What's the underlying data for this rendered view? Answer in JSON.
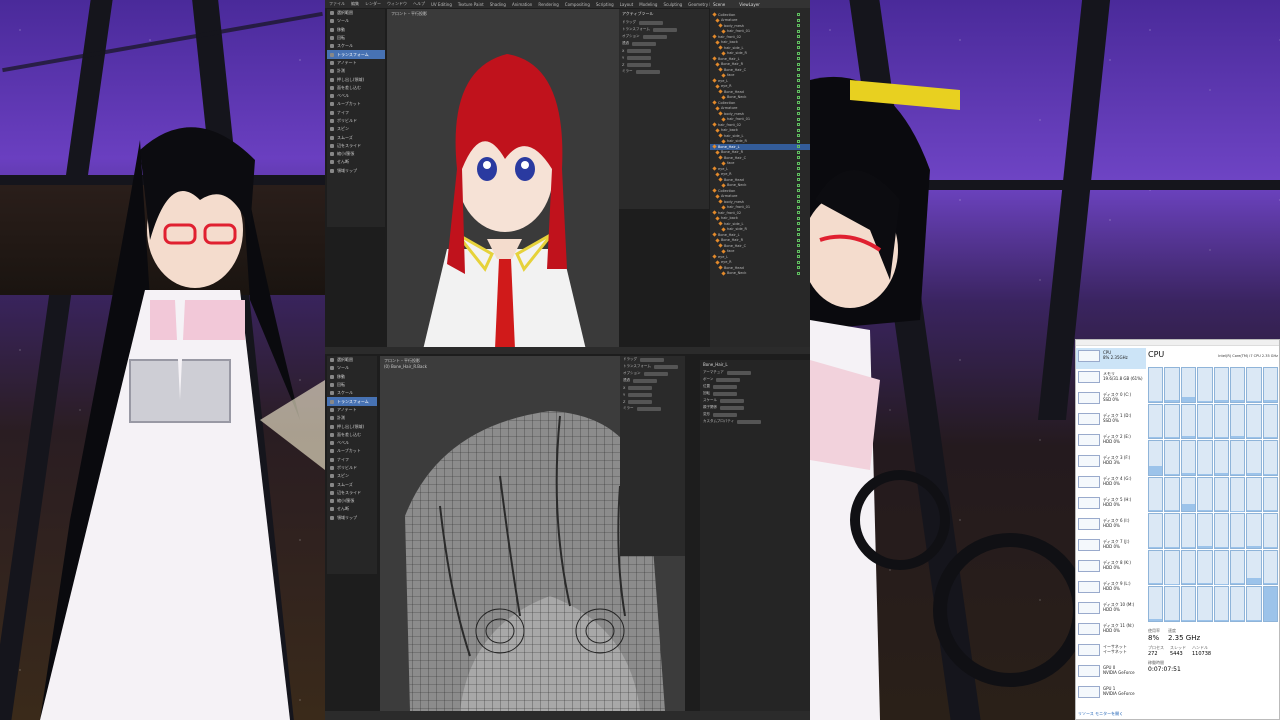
{
  "blender": {
    "topbar_menus": [
      "ファイル",
      "編集",
      "レンダー",
      "ウィンドウ",
      "ヘルプ",
      "UV Editing",
      "Texture Paint",
      "Shading",
      "Animation",
      "Rendering",
      "Compositing",
      "Scripting",
      "Layout",
      "Modeling",
      "Sculpting",
      "Geometry Nodes"
    ],
    "scene_label": "Scene",
    "view_layer_label": "ViewLayer",
    "top_tools": [
      "選択範囲",
      "ツール",
      "移動",
      "回転",
      "スケール",
      "トランスフォーム",
      "アノテート",
      "計測",
      "押し出し(領域)",
      "面を差し込む",
      "ベベル",
      "ループカット",
      "ナイフ",
      "ポリビルド",
      "スピン",
      "スムーズ",
      "辺をスライド",
      "縮小/膨張",
      "せん断",
      "領域リップ"
    ],
    "bottom_tools": [
      "選択範囲",
      "ツール",
      "移動",
      "回転",
      "スケール",
      "トランスフォーム",
      "アノテート",
      "計測",
      "押し出し(領域)",
      "面を差し込む",
      "ベベル",
      "ループカット",
      "ナイフ",
      "ポリビルド",
      "スピン",
      "スムーズ",
      "辺をスライド",
      "縮小/膨張",
      "せん断",
      "領域リップ"
    ],
    "outliner_rows": [
      "Collection",
      "Armature",
      "body_mesh",
      "hair_front_01",
      "hair_front_02",
      "hair_back",
      "hair_side_L",
      "hair_side_R",
      "Bone_Hair_L",
      "Bone_Hair_R",
      "Bone_Hair_C",
      "face",
      "eye_L",
      "eye_R",
      "Bone_Head",
      "Bone_Neck"
    ],
    "selected_row_index": 8,
    "viewport_top_info": "フロント・平行投影",
    "viewport_bottom_info": "フロント・平行投影",
    "viewport_bottom_sub": "(0) Bone_Hair_R.Back",
    "props_title": "アクティブツール",
    "props_rows": [
      "ドラッグ",
      "トランスフォーム",
      "オプション",
      "透過",
      "X",
      "Y",
      "Z",
      "ミラー"
    ],
    "props_right_title": "Bone_Hair_L",
    "props_right_rows": [
      "アーマチュア",
      "ボーン",
      "位置",
      "回転",
      "スケール",
      "親子関係",
      "変形",
      "カスタムプロパティ"
    ]
  },
  "taskmgr": {
    "side_items": [
      {
        "name": "CPU",
        "sub": "8% 2.35GHz"
      },
      {
        "name": "メモリ",
        "sub": "19.6/31.8 GB (61%)"
      },
      {
        "name": "ディスク 0 (C:)",
        "sub": "SSD 0%"
      },
      {
        "name": "ディスク 1 (D:)",
        "sub": "SSD 0%"
      },
      {
        "name": "ディスク 2 (E:)",
        "sub": "HDD 0%"
      },
      {
        "name": "ディスク 3 (F:)",
        "sub": "HDD 3%"
      },
      {
        "name": "ディスク 4 (G:)",
        "sub": "HDD 0%"
      },
      {
        "name": "ディスク 5 (H:)",
        "sub": "HDD 0%"
      },
      {
        "name": "ディスク 6 (I:)",
        "sub": "HDD 0%"
      },
      {
        "name": "ディスク 7 (J:)",
        "sub": "HDD 0%"
      },
      {
        "name": "ディスク 8 (K:)",
        "sub": "HDD 0%"
      },
      {
        "name": "ディスク 9 (L:)",
        "sub": "HDD 0%"
      },
      {
        "name": "ディスク 10 (M:)",
        "sub": "HDD 0%"
      },
      {
        "name": "ディスク 11 (N:)",
        "sub": "HDD 0%"
      },
      {
        "name": "イーサネット",
        "sub": "イーサネット"
      },
      {
        "name": "GPU 0",
        "sub": "NVIDIA GeForce"
      },
      {
        "name": "GPU 1",
        "sub": "NVIDIA GeForce"
      }
    ],
    "title": "CPU",
    "cpu_model": "Intel(R) Core(TM) i7 CPU 2.35 GHz",
    "utilization": "8%",
    "speed": "2.35 GHz",
    "processes": "272",
    "threads": "5443",
    "handles": "110738",
    "uptime": "0:07:07:51",
    "core_loads": [
      2,
      4,
      15,
      3,
      5,
      6,
      2,
      4,
      3,
      2,
      5,
      4,
      3,
      6,
      4,
      2,
      25,
      3,
      5,
      2,
      4,
      3,
      6,
      2,
      3,
      4,
      22,
      3,
      5,
      2,
      4,
      3,
      2,
      4,
      3,
      5,
      2,
      4,
      6,
      3,
      4,
      2,
      3,
      5,
      2,
      4,
      18,
      3,
      5,
      2,
      4,
      3,
      2,
      4,
      3,
      100
    ],
    "bottom_link": "リソース モニターを開く",
    "labels": {
      "util": "使用率",
      "speed": "速度",
      "procs": "プロセス",
      "threads": "スレッド",
      "handles": "ハンドル",
      "uptime": "稼働時間"
    }
  }
}
